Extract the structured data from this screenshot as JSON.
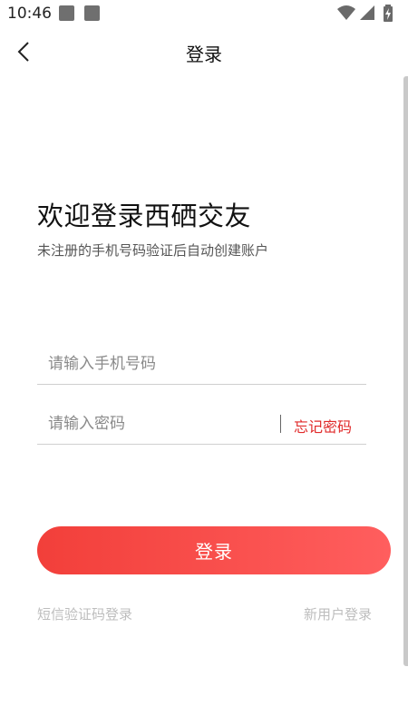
{
  "status_bar": {
    "time": "10:46",
    "icons": [
      "notification-square-icon",
      "notification-square-icon",
      "wifi-icon",
      "signal-icon",
      "battery-charging-icon"
    ]
  },
  "header": {
    "title": "登录",
    "back_icon": "chevron-left-icon"
  },
  "welcome": {
    "title": "欢迎登录西硒交友",
    "subtitle": "未注册的手机号码验证后自动创建账户"
  },
  "form": {
    "phone_placeholder": "请输入手机号码",
    "phone_value": "",
    "password_placeholder": "请输入密码",
    "password_value": "",
    "forgot_label": "忘记密码",
    "login_label": "登录"
  },
  "footer": {
    "sms_login_label": "短信验证码登录",
    "new_user_label": "新用户登录"
  },
  "colors": {
    "accent": "#f23f3a",
    "accent_end": "#ff5e5e",
    "link_red": "#e02a2a",
    "muted": "#bdbdbd"
  }
}
